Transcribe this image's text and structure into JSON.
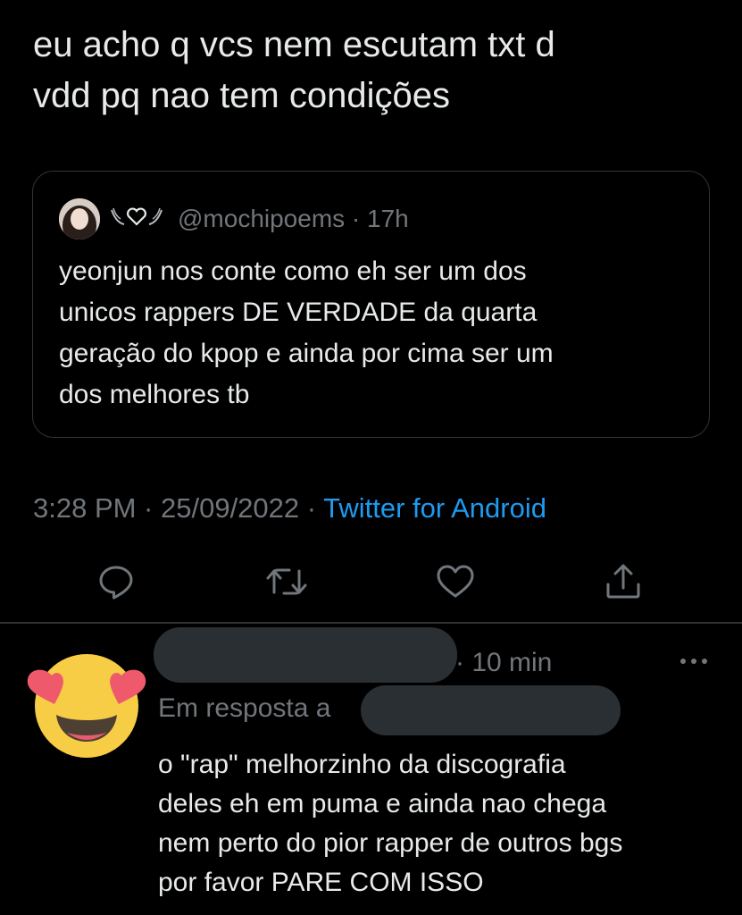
{
  "tweet": {
    "text": "eu acho q vcs nem escutam txt d\nvdd pq nao tem condições",
    "timestamp": "3:28 PM · 25/09/2022 · ",
    "source": "Twitter for Android"
  },
  "quoted_tweet": {
    "handle_time": "@mochipoems · 17h",
    "text": "yeonjun nos conte como eh ser um dos\nunicos rappers DE VERDADE da quarta\ngeração do kpop e ainda por cima ser um\ndos melhores tb"
  },
  "actions": {
    "icons": [
      "reply-icon",
      "retweet-icon",
      "like-icon",
      "share-icon"
    ]
  },
  "reply": {
    "time": "· 10 min",
    "reply_to_label": "Em resposta a",
    "text": "o \"rap\" melhorzinho da discografia\ndeles eh em puma e ainda nao chega\nnem perto do pior rapper de outros bgs\npor favor PARE COM ISSO"
  },
  "colors": {
    "background": "#000000",
    "text": "#e7e9ea",
    "muted": "#71767b",
    "link": "#1d9bf0",
    "border": "#2f3336",
    "redaction": "#2a2f33"
  }
}
